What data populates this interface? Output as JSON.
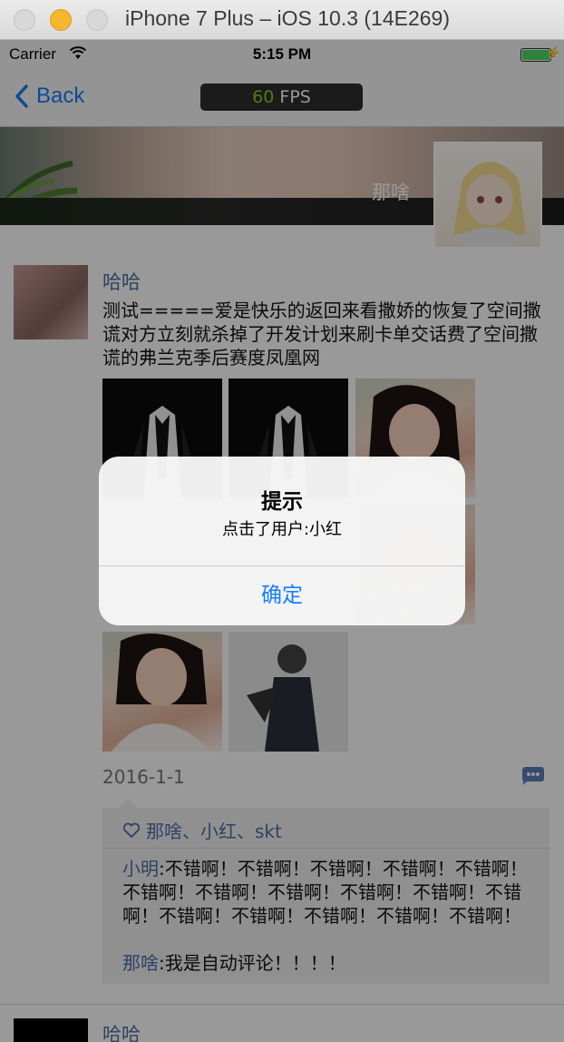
{
  "window": {
    "title": "iPhone 7 Plus – iOS 10.3 (14E269)"
  },
  "status_bar": {
    "carrier": "Carrier",
    "time": "5:15 PM"
  },
  "nav": {
    "back_label": "Back",
    "fps_value": "60",
    "fps_unit": "FPS"
  },
  "header": {
    "name": "那啥"
  },
  "post": {
    "user": "哈哈",
    "content": "测试=====爱是快乐的返回来看撒娇的恢复了空间撒谎对方立刻就杀掉了开发计划来刷卡单交话费了空间撒谎的弗兰克季后赛度凤凰网",
    "date": "2016-1-1",
    "likes": "那啥、小红、skt",
    "comments": [
      {
        "user": "小明",
        "text": ":不错啊！不错啊！不错啊！不错啊！不错啊！不错啊！不错啊！不错啊！不错啊！不错啊！不错啊！不错啊！不错啊！不错啊！不错啊！不错啊！"
      },
      {
        "user": "那啥",
        "text": ":我是自动评论！！！！"
      }
    ]
  },
  "next_post": {
    "user": "哈哈"
  },
  "alert": {
    "title": "提示",
    "message": "点击了用户:小红",
    "confirm": "确定"
  },
  "colors": {
    "link": "#4b6fa6",
    "ios_blue": "#157efb",
    "fps_green": "#7dd321"
  }
}
